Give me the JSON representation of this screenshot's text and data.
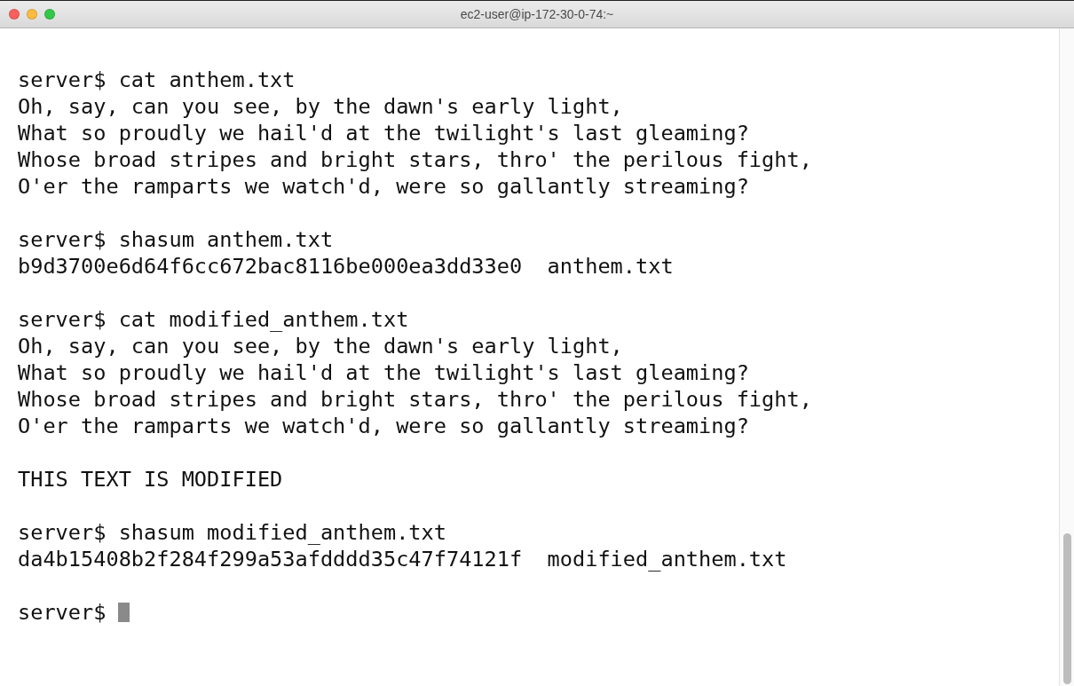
{
  "window": {
    "title": "ec2-user@ip-172-30-0-74:~"
  },
  "lines": [
    {
      "kind": "command",
      "prompt": "server$",
      "command": "cat anthem.txt"
    },
    {
      "kind": "output",
      "text": "Oh, say, can you see, by the dawn's early light,"
    },
    {
      "kind": "output",
      "text": "What so proudly we hail'd at the twilight's last gleaming?"
    },
    {
      "kind": "output",
      "text": "Whose broad stripes and bright stars, thro' the perilous fight,"
    },
    {
      "kind": "output",
      "text": "O'er the ramparts we watch'd, were so gallantly streaming?"
    },
    {
      "kind": "gap"
    },
    {
      "kind": "command",
      "prompt": "server$",
      "command": "shasum anthem.txt"
    },
    {
      "kind": "output",
      "text": "b9d3700e6d64f6cc672bac8116be000ea3dd33e0  anthem.txt"
    },
    {
      "kind": "gap"
    },
    {
      "kind": "command",
      "prompt": "server$",
      "command": "cat modified_anthem.txt"
    },
    {
      "kind": "output",
      "text": "Oh, say, can you see, by the dawn's early light,"
    },
    {
      "kind": "output",
      "text": "What so proudly we hail'd at the twilight's last gleaming?"
    },
    {
      "kind": "output",
      "text": "Whose broad stripes and bright stars, thro' the perilous fight,"
    },
    {
      "kind": "output",
      "text": "O'er the ramparts we watch'd, were so gallantly streaming?"
    },
    {
      "kind": "gap"
    },
    {
      "kind": "output",
      "text": "THIS TEXT IS MODIFIED"
    },
    {
      "kind": "gap"
    },
    {
      "kind": "command",
      "prompt": "server$",
      "command": "shasum modified_anthem.txt"
    },
    {
      "kind": "output",
      "text": "da4b15408b2f284f299a53afdddd35c47f74121f  modified_anthem.txt"
    },
    {
      "kind": "gap"
    },
    {
      "kind": "input",
      "prompt": "server$",
      "cursor": true
    }
  ]
}
